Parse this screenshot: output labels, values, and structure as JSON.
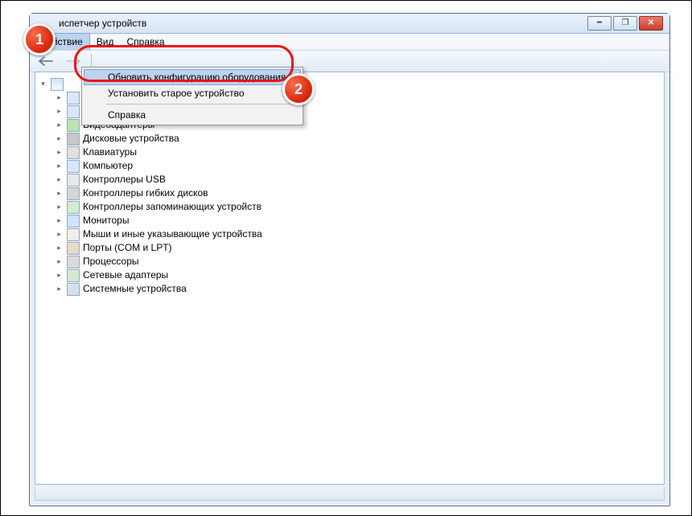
{
  "window": {
    "title": "испетчер устройств"
  },
  "menubar": {
    "action": "Действие",
    "view": "Вид",
    "help": "Справка"
  },
  "dropdown": {
    "scan": "Обновить конфигурацию оборудования",
    "legacy": "Установить старое устройство",
    "help": "Справка"
  },
  "tree": {
    "items": [
      {
        "label": "Видеоадаптеры"
      },
      {
        "label": "Дисковые устройства"
      },
      {
        "label": "Клавиатуры"
      },
      {
        "label": "Компьютер"
      },
      {
        "label": "Контроллеры USB"
      },
      {
        "label": "Контроллеры гибких дисков"
      },
      {
        "label": "Контроллеры запоминающих устройств"
      },
      {
        "label": "Мониторы"
      },
      {
        "label": "Мыши и иные указывающие устройства"
      },
      {
        "label": "Порты (COM и LPT)"
      },
      {
        "label": "Процессоры"
      },
      {
        "label": "Сетевые адаптеры"
      },
      {
        "label": "Системные устройства"
      }
    ]
  },
  "markers": {
    "m1": "1",
    "m2": "2"
  }
}
